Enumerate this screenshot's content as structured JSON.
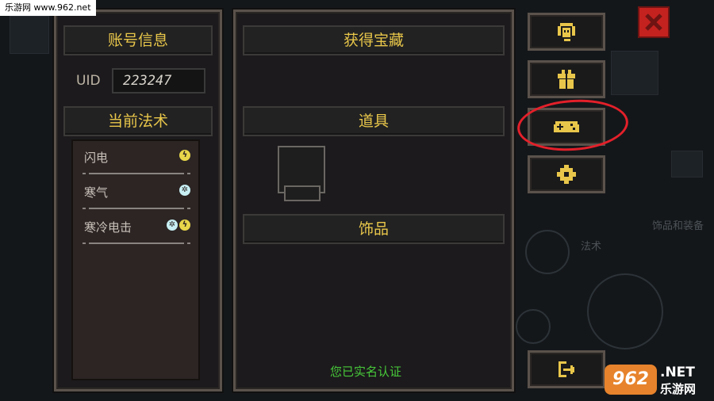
{
  "watermark_top": "乐游网 www.962.net",
  "account_panel": {
    "title": "账号信息",
    "uid_label": "UID",
    "uid_value": "223247",
    "spells_title": "当前法术",
    "spells": [
      {
        "name": "闪电",
        "elements": [
          "lightning"
        ]
      },
      {
        "name": "寒气",
        "elements": [
          "ice"
        ]
      },
      {
        "name": "寒冷电击",
        "elements": [
          "ice",
          "lightning"
        ]
      }
    ]
  },
  "treasure_panel": {
    "title": "获得宝藏",
    "items_title": "道具",
    "accessories_title": "饰品",
    "verified_text": "您已实名认证",
    "verified_color": "#47c93a"
  },
  "side_buttons": [
    {
      "name": "support-button",
      "icon": "headset-icon"
    },
    {
      "name": "gift-button",
      "icon": "gift-icon"
    },
    {
      "name": "gamepad-button",
      "icon": "gamepad-icon",
      "highlighted": true
    },
    {
      "name": "settings-button",
      "icon": "gear-icon"
    },
    {
      "name": "exit-button",
      "icon": "exit-icon"
    }
  ],
  "background": {
    "label_equipment": "饰品和装备",
    "label_spell": "法术"
  },
  "watermark_bottom": {
    "logo": "962",
    "net": ".NET",
    "cn": "乐游网"
  },
  "colors": {
    "gold": "#e8c64a",
    "annotation_red": "#e3202a",
    "close_red": "#c4221f"
  }
}
